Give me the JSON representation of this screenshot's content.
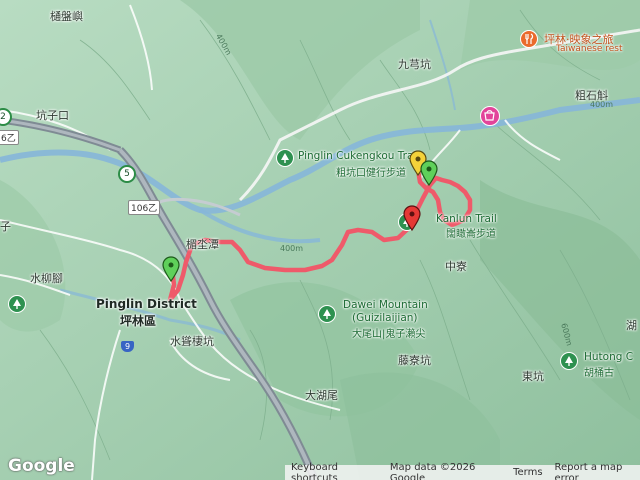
{
  "map": {
    "labels": {
      "tongpanjie": "樋盤嶼",
      "kengzikou": "坑子口",
      "jiuqiongkeng": "九芎坑",
      "cushichan": "粗石斛",
      "zi_left": "子",
      "shuiliujiao": "水柳腳",
      "lishiui": "楣坔潭",
      "zhongliao": "中寮",
      "shuidenghengkeng": "水聳棲坑",
      "tenganliaokeng": "藤寮坑",
      "dongkeng": "東坑",
      "dahuwei": "大湖尾",
      "hu_right": "湖",
      "pinglin_en": "Pinglin District",
      "pinglin_zh": "坪林區",
      "cukengkou_en": "Pinglin Cukengkou Trail",
      "cukengkou_zh": "粗坑口健行步道",
      "kanlun_en": "Kanlun Trail",
      "kanlun_zh": "闊瞰崙步道",
      "dawei_en": "Dawei Mountain",
      "dawei_en2": "(Guizilaijian)",
      "dawei_zh": "大尾山|鬼子瀨尖",
      "hutong_en": "Hutong C",
      "hutong_zh": "胡桶古",
      "biz_zh": "坪林·映象之旅",
      "biz_en": "Taiwanese rest",
      "road_106": "106乙",
      "road_9": "9",
      "road_5": "5",
      "road_2": "2",
      "road_6": "6乙",
      "elev_400_a": "400m",
      "elev_400_b": "400m",
      "elev_400_c": "400m",
      "elev_600": "600m"
    },
    "icons": {
      "park": "park-icon",
      "marker_green": "start-marker-icon",
      "marker_red": "trailhead-marker-icon",
      "marker_yellow": "summit-marker-icon",
      "shop": "shopping-icon",
      "restaurant": "restaurant-icon"
    },
    "colors": {
      "route": "#ef5a6a",
      "water": "#86b6d9",
      "highway": "#7f8b94",
      "terrain": "#a9d3b4"
    },
    "footer": {
      "logo": "Google",
      "keyboard": "Keyboard shortcuts",
      "mapdata": "Map data ©2026 Google",
      "terms": "Terms",
      "report": "Report a map error"
    }
  }
}
